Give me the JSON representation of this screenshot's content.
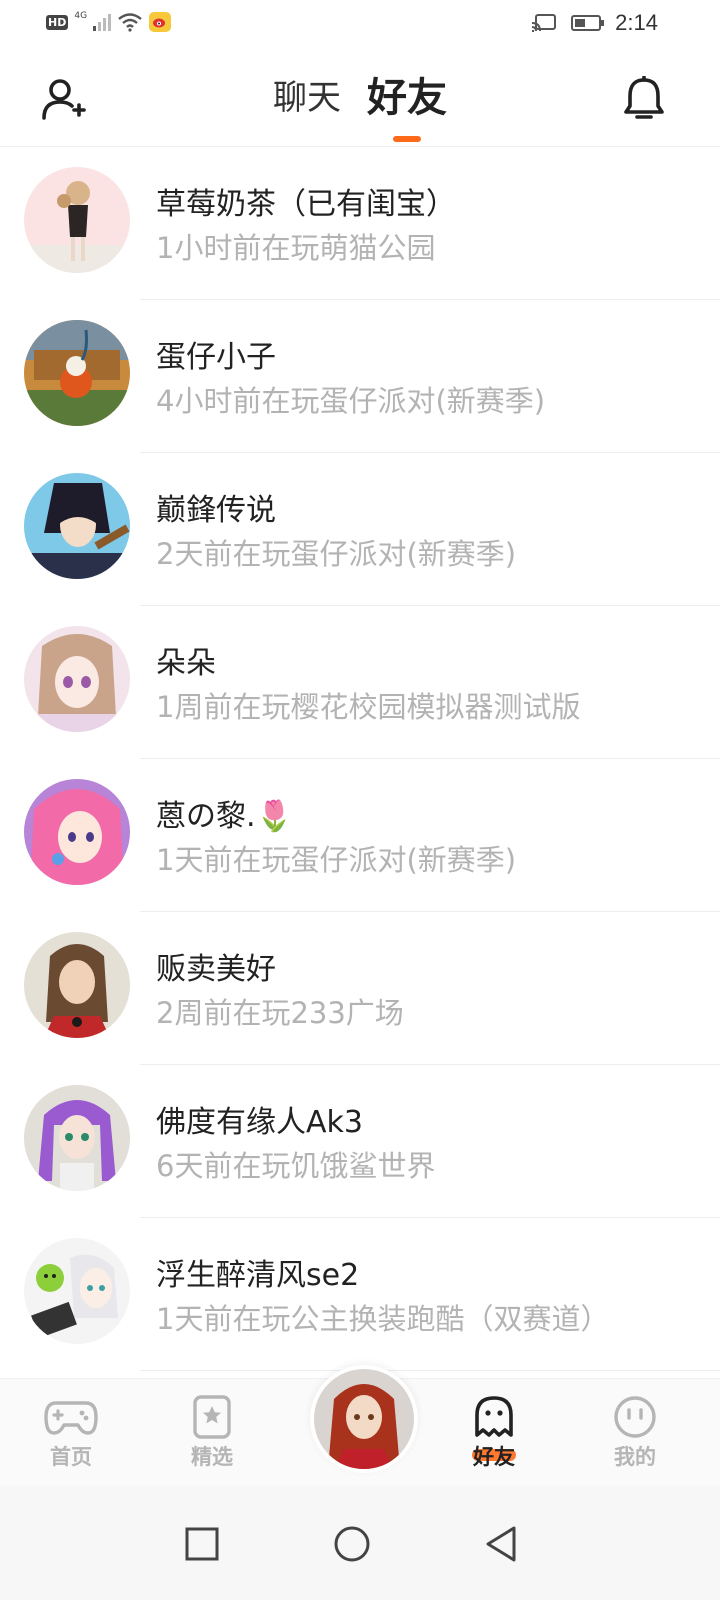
{
  "status_bar": {
    "hd_label": "HD",
    "network_label": "4G",
    "time": "2:14",
    "battery_level": 0.45
  },
  "header": {
    "tabs": [
      {
        "label": "聊天",
        "active": false
      },
      {
        "label": "好友",
        "active": true
      }
    ],
    "accent_color": "#ff6a1a"
  },
  "friends": [
    {
      "name": "草莓奶茶（已有闺宝）",
      "status": "1小时前在玩萌猫公园"
    },
    {
      "name": "蛋仔小子",
      "status": "4小时前在玩蛋仔派对(新赛季)"
    },
    {
      "name": "巅鋒传说",
      "status": "2天前在玩蛋仔派对(新赛季)"
    },
    {
      "name": "朵朵",
      "status": "1周前在玩樱花校园模拟器测试版"
    },
    {
      "name": "蒽の黎.🌷",
      "status": "1天前在玩蛋仔派对(新赛季)"
    },
    {
      "name": "贩卖美好",
      "status": "2周前在玩233广场"
    },
    {
      "name": "佛度有缘人Ak3",
      "status": "6天前在玩饥饿鲨世界"
    },
    {
      "name": "浮生醉清风se2",
      "status": "1天前在玩公主换装跑酷（双赛道）"
    }
  ],
  "bottom_nav": {
    "items": [
      {
        "label": "首页",
        "icon": "gamepad-icon",
        "active": false
      },
      {
        "label": "精选",
        "icon": "star-card-icon",
        "active": false
      },
      {
        "label": "好友",
        "icon": "ghost-icon",
        "active": true
      },
      {
        "label": "我的",
        "icon": "smiley-icon",
        "active": false
      }
    ]
  }
}
